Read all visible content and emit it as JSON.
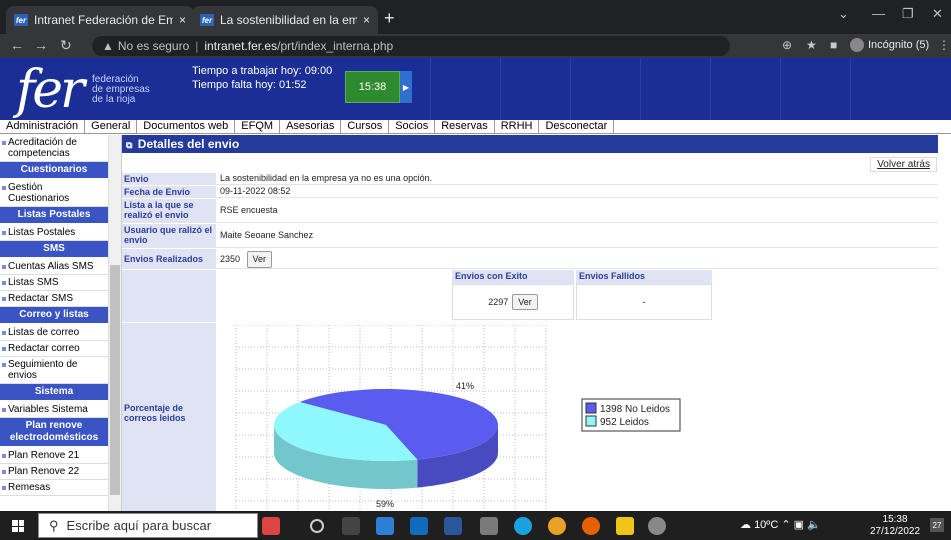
{
  "browser": {
    "tabs": [
      {
        "title": "Intranet Federación de Empresas",
        "close": "×"
      },
      {
        "title": "La sostenibilidad en la empresa y",
        "close": "×"
      }
    ],
    "new_tab": "+",
    "url_warning": "No es seguro",
    "url_host": "intranet.fer.es",
    "url_path": "/prt/index_interna.php",
    "incognito_label": "Incógnito (5)"
  },
  "header": {
    "logo_word": "fer",
    "logo_lines": [
      "federación",
      "de empresas",
      "de la rioja"
    ],
    "work_today": "Tiempo a trabajar hoy: 09:00",
    "time_left": "Tiempo falta hoy: 01:52",
    "clock": "15:38"
  },
  "topmenu": [
    "Administración",
    "General",
    "Documentos web",
    "EFQM",
    "Asesorias",
    "Cursos",
    "Socios",
    "Reservas",
    "RRHH",
    "Desconectar"
  ],
  "sidebar": {
    "cut_top": "Acreditación de competencias",
    "sections": [
      {
        "title": "Cuestionarios",
        "items": [
          "Gestión Cuestionarios"
        ]
      },
      {
        "title": "Listas Postales",
        "items": [
          "Listas Postales"
        ]
      },
      {
        "title": "SMS",
        "items": [
          "Cuentas Alias SMS",
          "Listas SMS",
          "Redactar SMS"
        ]
      },
      {
        "title": "Correo y listas",
        "items": [
          "Listas de correo",
          "Redactar correo",
          "Seguimiento de envios"
        ]
      },
      {
        "title": "Sistema",
        "items": [
          "Variables Sistema"
        ]
      },
      {
        "title": "Plan renove electrodomésticos",
        "items": [
          "Plan Renove 21",
          "Plan Renove 22",
          "Remesas"
        ]
      }
    ]
  },
  "detail": {
    "title": "Detalles del envio",
    "back_link": "Volver atrás",
    "rows": {
      "envio_label": "Envio",
      "envio_value": "La sostenibilidad en la empresa ya no es una opción.",
      "fecha_label": "Fecha de Envio",
      "fecha_value": "09-11-2022 08:52",
      "lista_label": "Lista a la que se realizó el envio",
      "lista_value": "RSE encuesta",
      "usuario_label": "Usuario que ralizó el envio",
      "usuario_value": "Maite Seoane Sanchez",
      "realizados_label": "Envios Realizados",
      "realizados_value": "2350",
      "ver": "Ver"
    },
    "exito_header": "Envios con Exito",
    "fallidos_header": "Envios Fallidos",
    "exito_value": "2297",
    "fallidos_value": "-",
    "chart_label": "Porcentaje de correos leidos"
  },
  "chart_data": {
    "type": "pie",
    "title": "",
    "slices": [
      {
        "name": "No Leidos",
        "value": 1398,
        "label": "59%",
        "legend": "1398 No Leidos",
        "color": "#5a5cf0"
      },
      {
        "name": "Leidos",
        "value": 952,
        "label": "41%",
        "legend": "952 Leidos",
        "color": "#8ff8ff"
      }
    ],
    "legend_position": "right"
  },
  "taskbar": {
    "search_placeholder": "Escribe aquí para buscar",
    "weather": "10ºC",
    "time": "15:38",
    "date": "27/12/2022",
    "notif": "27"
  }
}
